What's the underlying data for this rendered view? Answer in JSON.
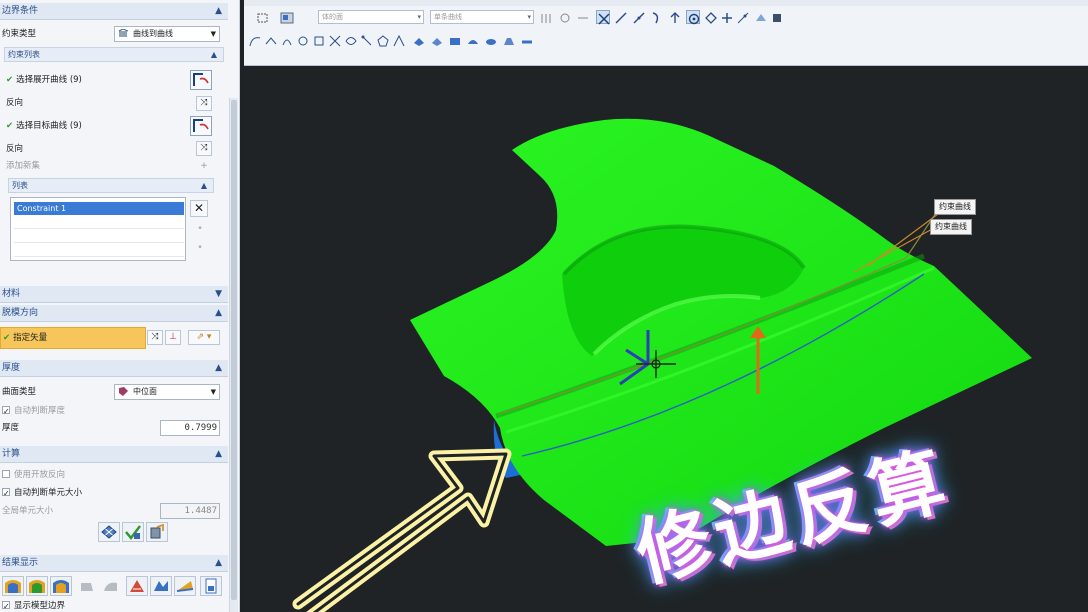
{
  "panel": {
    "boundary_section": "边界条件",
    "constraint_type_label": "约束类型",
    "constraint_type_value": "曲线到曲线",
    "constraint_list_label": "约束列表",
    "select_open_curve": "选择展开曲线 (9)",
    "reverse_1": "反向",
    "select_target_curve": "选择目标曲线 (9)",
    "reverse_2": "反向",
    "add_new_set": "添加新集",
    "list_label": "列表",
    "list_items": [
      "Constraint 1"
    ],
    "material_section": "材料",
    "draw_direction_section": "脱模方向",
    "specify_vector": "指定矢量",
    "thickness_section": "厚度",
    "surface_type_label": "曲面类型",
    "surface_type_value": "中位面",
    "auto_thickness_label": "自动判断厚度",
    "thickness_label": "厚度",
    "thickness_value": "0.7999",
    "compute_section": "计算",
    "use_open_reverse": "使用开放反向",
    "auto_element_size": "自动判断单元大小",
    "global_element_size_label": "全局单元大小",
    "global_element_size_value": "1.4487",
    "result_display_section": "结果显示",
    "show_model_boundary": "显示模型边界"
  },
  "toolbar": {
    "combo_filter_placeholder": "体的面",
    "combo_rule_placeholder": "单条曲线"
  },
  "viewport": {
    "callout_1": "约束曲线",
    "callout_2": "约束曲线",
    "overlay_text": "修边反算"
  },
  "colors": {
    "part_green": "#1ee61a",
    "accent_blue": "#3a7bd5",
    "highlight_orange": "#f7c65a",
    "arrow_yellow": "#fbf2a6"
  }
}
